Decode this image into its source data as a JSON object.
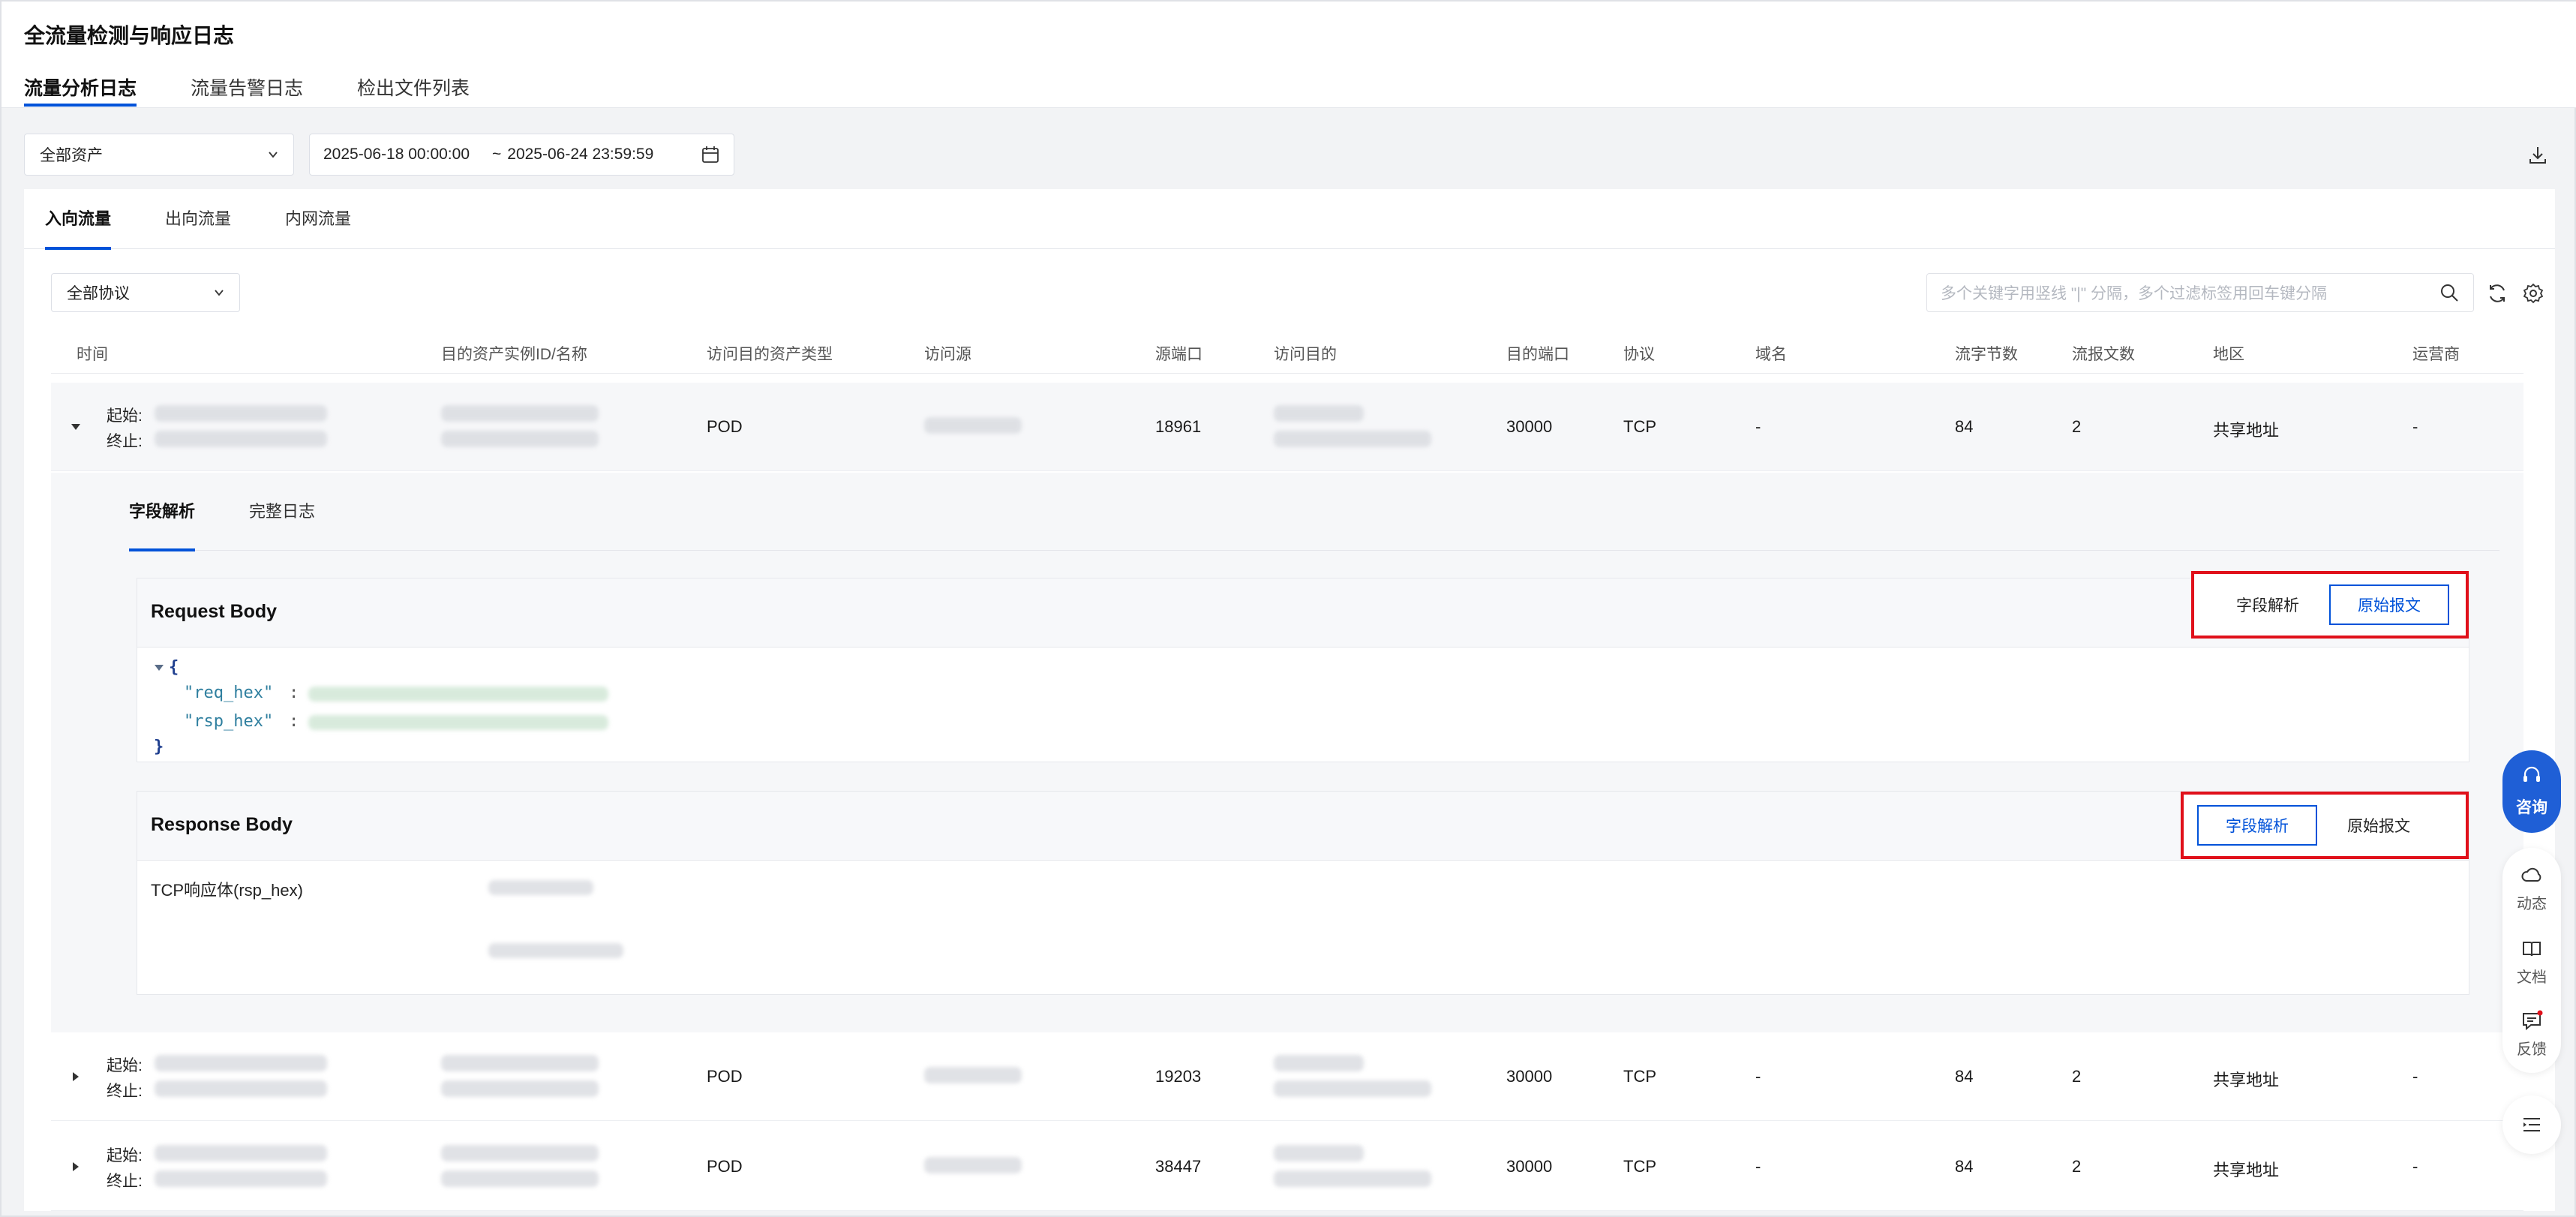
{
  "page": {
    "title": "全流量检测与响应日志",
    "tabs": [
      "流量分析日志",
      "流量告警日志",
      "检出文件列表"
    ]
  },
  "filters": {
    "asset": "全部资产",
    "date_start": "2025-06-18 00:00:00",
    "date_sep": "~",
    "date_end": "2025-06-24 23:59:59"
  },
  "flow_tabs": [
    "入向流量",
    "出向流量",
    "内网流量"
  ],
  "protocol": "全部协议",
  "search": {
    "placeholder": "多个关键字用竖线 \"|\" 分隔，多个过滤标签用回车键分隔"
  },
  "table": {
    "columns": [
      "时间",
      "目的资产实例ID/名称",
      "访问目的资产类型",
      "访问源",
      "源端口",
      "访问目的",
      "目的端口",
      "协议",
      "域名",
      "流字节数",
      "流报文数",
      "地区",
      "运营商"
    ],
    "start_label": "起始:",
    "end_label": "终止:",
    "rows": [
      {
        "asset_type": "POD",
        "src_port": "18961",
        "dst_port": "30000",
        "protocol": "TCP",
        "domain": "-",
        "bytes": "84",
        "packets": "2",
        "region": "共享地址",
        "isp": "-"
      },
      {
        "asset_type": "POD",
        "src_port": "19203",
        "dst_port": "30000",
        "protocol": "TCP",
        "domain": "-",
        "bytes": "84",
        "packets": "2",
        "region": "共享地址",
        "isp": "-"
      },
      {
        "asset_type": "POD",
        "src_port": "38447",
        "dst_port": "30000",
        "protocol": "TCP",
        "domain": "-",
        "bytes": "84",
        "packets": "2",
        "region": "共享地址",
        "isp": "-"
      }
    ]
  },
  "detail": {
    "tabs": [
      "字段解析",
      "完整日志"
    ],
    "request": {
      "title": "Request Body",
      "toggle": [
        "字段解析",
        "原始报文"
      ],
      "active": "原始报文",
      "json_open": "{",
      "json_close": "}",
      "keys": [
        "\"req_hex\"",
        "\"rsp_hex\""
      ],
      "colon": ":"
    },
    "response": {
      "title": "Response Body",
      "toggle": [
        "字段解析",
        "原始报文"
      ],
      "active": "字段解析",
      "field_label": "TCP响应体(rsp_hex)"
    }
  },
  "float_bar": {
    "consult": "咨询",
    "items": [
      "动态",
      "文档",
      "反馈"
    ]
  },
  "colors": {
    "accent": "#0052d9",
    "highlight_border": "#e0101a",
    "consult_bg": "#1f5fd6"
  }
}
